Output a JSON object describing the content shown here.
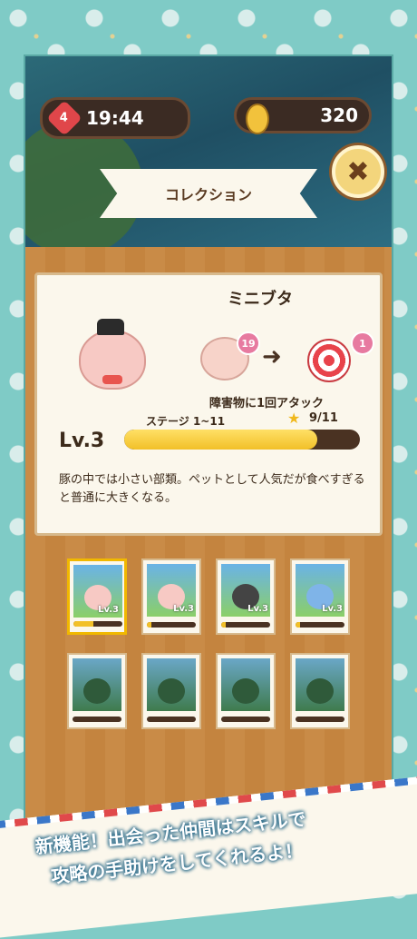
{
  "hud": {
    "lives": "4",
    "timer": "19:44",
    "coins": "320"
  },
  "header": {
    "title": "コレクション"
  },
  "detail": {
    "name": "ミニブタ",
    "count_badge": "19",
    "target_badge": "1",
    "skill": "障害物に1回アタック",
    "level": "Lv.3",
    "stage": "ステージ 1~11",
    "progress": "9/11",
    "progress_fraction": 0.82,
    "description": "豚の中では小さい部類。ペットとして人気だが食べすぎると普通に大きくなる。"
  },
  "cards": [
    {
      "level": "Lv.3",
      "progress": 0.4
    },
    {
      "level": "Lv.3",
      "progress": 0.1
    },
    {
      "level": "Lv.3",
      "progress": 0.1
    },
    {
      "level": "Lv.3",
      "progress": 0.1
    }
  ],
  "banner": {
    "line1": "新機能！出会った仲間はスキルで",
    "line2": "攻略の手助けをしてくれるよ！"
  }
}
